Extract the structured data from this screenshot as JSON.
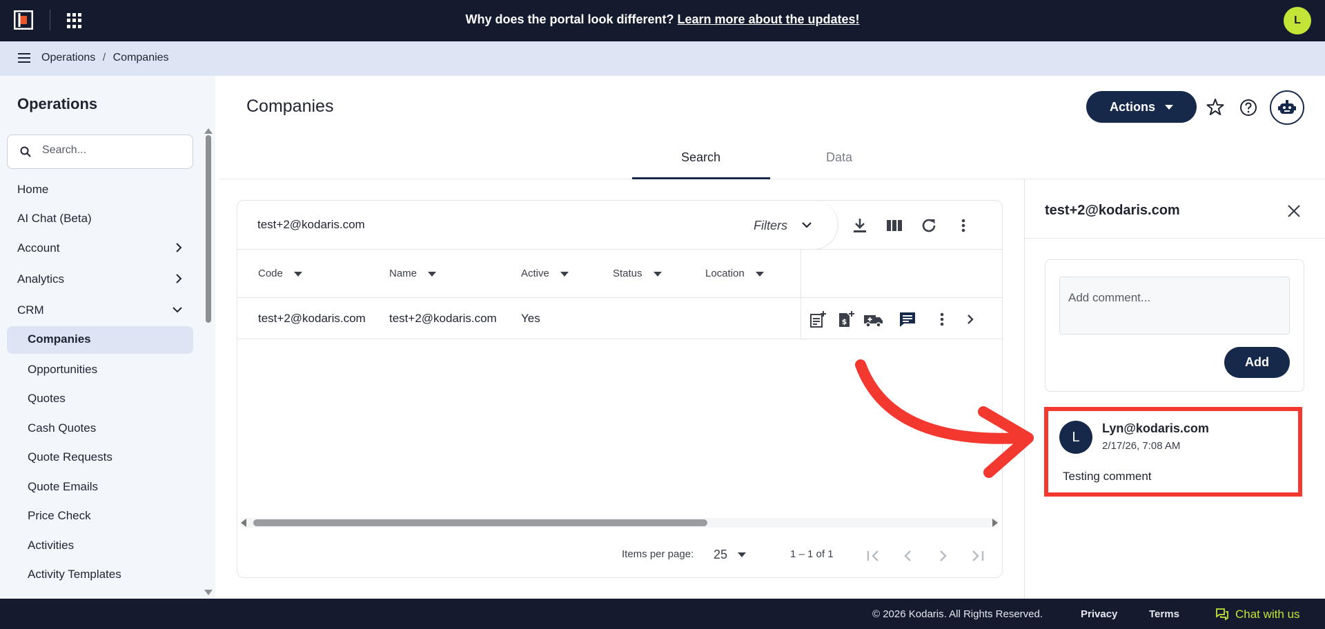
{
  "topbar": {
    "banner_text": "Why does the portal look different?",
    "banner_link": "Learn more about the updates!",
    "user_initial": "L"
  },
  "breadcrumb": [
    "Operations",
    "/",
    "Companies"
  ],
  "sidebar": {
    "title": "Operations",
    "search_placeholder": "Search...",
    "items": [
      {
        "label": "Home"
      },
      {
        "label": "AI Chat (Beta)"
      },
      {
        "label": "Account"
      },
      {
        "label": "Analytics"
      },
      {
        "label": "CRM"
      }
    ],
    "sub_items": [
      {
        "label": "Companies",
        "active": true
      },
      {
        "label": "Opportunities"
      },
      {
        "label": "Quotes"
      },
      {
        "label": "Cash Quotes"
      },
      {
        "label": "Quote Requests"
      },
      {
        "label": "Quote Emails"
      },
      {
        "label": "Price Check"
      },
      {
        "label": "Activities"
      },
      {
        "label": "Activity Templates"
      }
    ]
  },
  "header": {
    "title": "Companies",
    "actions_label": "Actions"
  },
  "tabs": [
    {
      "label": "Search",
      "active": true
    },
    {
      "label": "Data",
      "active": false
    }
  ],
  "table": {
    "search_value": "test+2@kodaris.com",
    "filters_label": "Filters",
    "columns": [
      "Code",
      "Name",
      "Active",
      "Status",
      "Location"
    ],
    "rows": [
      {
        "code": "test+2@kodaris.com",
        "name": "test+2@kodaris.com",
        "active": "Yes",
        "status": "",
        "location": ""
      }
    ],
    "pager": {
      "items_per_page_label": "Items per page:",
      "items_per_page": "25",
      "range": "1 – 1 of 1"
    }
  },
  "panel": {
    "title": "test+2@kodaris.com",
    "comment_placeholder": "Add comment...",
    "add_label": "Add",
    "comments": [
      {
        "initial": "L",
        "author": "Lyn@kodaris.com",
        "time": "2/17/26, 7:08 AM",
        "text": "Testing comment"
      }
    ]
  },
  "footer": {
    "copyright": "© 2026 Kodaris. All Rights Reserved.",
    "privacy": "Privacy",
    "terms": "Terms",
    "chat": "Chat with us"
  },
  "colors": {
    "navy": "#141b2e",
    "accent": "#17294a",
    "lime": "#c4e538",
    "highlight_red": "#f2382f"
  }
}
